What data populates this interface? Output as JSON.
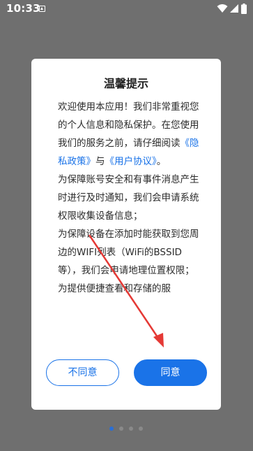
{
  "status_bar": {
    "time": "10:33",
    "icons": [
      "notification-icon",
      "wifi-icon",
      "signal-icon",
      "battery-icon"
    ]
  },
  "dialog": {
    "title": "温馨提示",
    "paragraph1_a": "欢迎使用本应用！我们非常重视您的个人信息和隐私保护。在您使用我们的服务之前，请仔细阅读",
    "privacy_link": "《隐私政策》",
    "conjunction": "与",
    "agreement_link": "《用户协议》",
    "paragraph1_end": "。",
    "paragraph2": "为保障账号安全和有事件消息产生时进行及时通知，我们会申请系统权限收集设备信息；",
    "paragraph3": "为保障设备在添加时能获取到您周边的WIFI列表（WiFi的BSSID等），我们会申请地理位置权限；",
    "paragraph4": "为提供便捷查看和存储的服",
    "disagree_button": "不同意",
    "agree_button": "同意"
  },
  "colors": {
    "accent": "#1a73e8",
    "annotation_arrow": "#e53935",
    "overlay": "#6f6f6f"
  },
  "pager": {
    "count": 4,
    "active_index": 0
  }
}
